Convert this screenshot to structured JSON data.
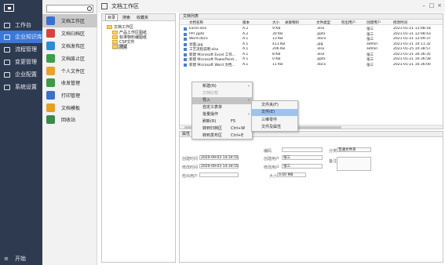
{
  "nav": {
    "items": [
      {
        "label": "工作台",
        "icon": "monitor-icon"
      },
      {
        "label": "企业知识库",
        "icon": "library-icon"
      },
      {
        "label": "流程管理",
        "icon": "flow-icon"
      },
      {
        "label": "变更管理",
        "icon": "chart-icon"
      },
      {
        "label": "企业配置",
        "icon": "config-icon"
      },
      {
        "label": "系统设置",
        "icon": "gear-icon"
      }
    ],
    "start_label": "开始"
  },
  "sidebar": {
    "items": [
      {
        "label": "文档工作区",
        "color": "#3b6fd4"
      },
      {
        "label": "文档归档区",
        "color": "#d94141"
      },
      {
        "label": "文档发布区",
        "color": "#2e8bd8"
      },
      {
        "label": "文档废止区",
        "color": "#3e9c4d"
      },
      {
        "label": "个人文件区",
        "color": "#e7a22c"
      },
      {
        "label": "收发管理",
        "color": "#3c9a46"
      },
      {
        "label": "打印管理",
        "color": "#3f6fc8"
      },
      {
        "label": "文档模板",
        "color": "#e6a01f"
      },
      {
        "label": "回收站",
        "color": "#3a8a4a"
      }
    ]
  },
  "main": {
    "title": "文档工作区",
    "tree": {
      "tabs": [
        "目录",
        "搜索",
        "收藏夹"
      ],
      "root": "文档工作区",
      "children": [
        "产品工作区图纸",
        "标准物料编图纸",
        "CSP文件",
        "测试"
      ]
    },
    "files": {
      "tab": "文档列表",
      "columns": [
        "文档名称",
        "版本",
        "大小",
        "关联物料",
        "文件类型",
        "检出用户",
        "创建用户",
        "修改时间"
      ],
      "rows": [
        [
          "Excel.xlsx",
          "A.2",
          "9 KB",
          "",
          ".xlsx",
          "",
          "张三",
          "2021-01-21 12:08:18"
        ],
        [
          "PPT.pptx",
          "A.2",
          "30 KB",
          "",
          ".pptx",
          "",
          "张三",
          "2021-01-21 12:08:43"
        ],
        [
          "Word.docx",
          "A.1",
          "13 KB",
          "",
          ".docx",
          "",
          "张三",
          "2021-01-21 12:09:37"
        ],
        [
          "封面.jpg",
          "A.1",
          "411 KB",
          "",
          ".jpg",
          "",
          "admin",
          "2021-01-21 10:11:32"
        ],
        [
          "工艺流程说明.xlsx",
          "A.1",
          "206 KB",
          "",
          ".xlsx",
          "",
          "admin",
          "2021-01-25 10:38:57"
        ],
        [
          "新建 Microsoft Excel 工作...",
          "A.1",
          "8 KB",
          "",
          ".xlsx",
          "",
          "张三",
          "2021-01-21 16:36:35"
        ],
        [
          "新建 Microsoft PowerPoint...",
          "A.1",
          "0 KB",
          "",
          ".pptx",
          "",
          "张三",
          "2021-01-21 16:36:58"
        ],
        [
          "新建 Microsoft Word 文档...",
          "A.1",
          "11 KB",
          "",
          ".docx",
          "",
          "张三",
          "2021-01-21 16:36:00"
        ]
      ]
    },
    "props": {
      "tabs": [
        "属性",
        "版本",
        "引用",
        "流程",
        "日志"
      ],
      "created_label": "创建时间",
      "created_value": "2020-09-03 14:34:55",
      "modified_label": "修改时间",
      "modified_value": "2020-09-03 14:34:55",
      "checkout_label": "检出用户",
      "code_label": "编码",
      "creator_label": "创建用户",
      "creator_value": "张三",
      "modifier_label": "修改用户",
      "modifier_value": "张三",
      "size_label": "大小",
      "size_value": "0.00 MB",
      "category_label": "分类",
      "category_value": "普通文件夹",
      "note_label": "备注"
    }
  },
  "context_menu": {
    "items": [
      {
        "label": "新建(N)",
        "arrow": "›"
      },
      {
        "label": "文档比较",
        "disabled": true
      },
      {
        "label": "导入",
        "arrow": "›"
      },
      {
        "label": "自定义表单"
      },
      {
        "label": "批量操作",
        "arrow": "›"
      },
      {
        "label": "刷新(R)",
        "shortcut": "F5"
      },
      {
        "label": "转到归档区",
        "shortcut": "Ctrl+W"
      },
      {
        "label": "转到发布区",
        "shortcut": "Ctrl+E"
      }
    ],
    "submenu": [
      "文件夹(F)",
      "文件(E)",
      "三维零件",
      "文件及属性"
    ]
  }
}
